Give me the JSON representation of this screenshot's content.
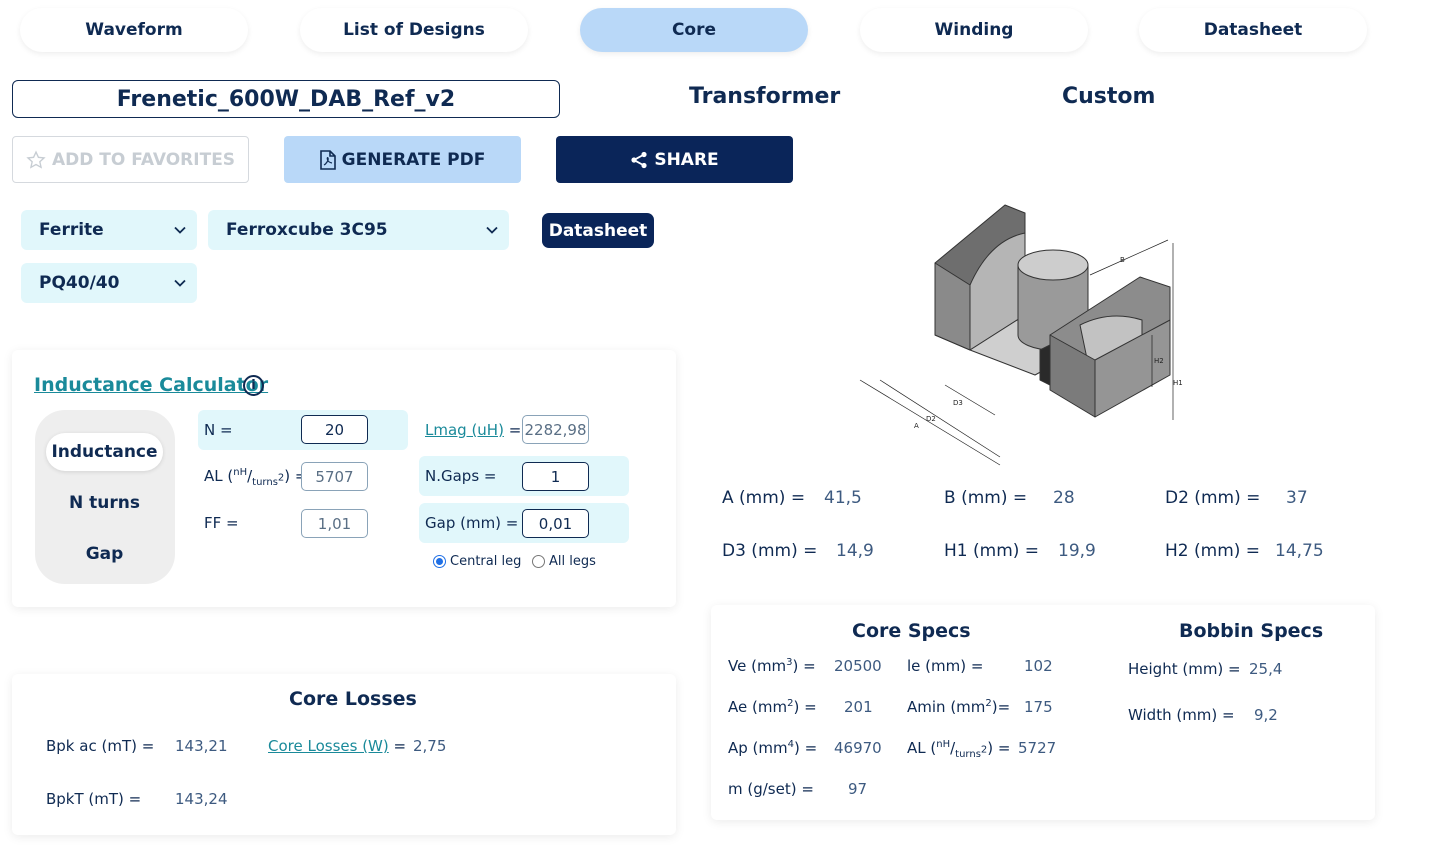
{
  "tabs": [
    "Waveform",
    "List of Designs",
    "Core",
    "Winding",
    "Datasheet"
  ],
  "design": {
    "name": "Frenetic_600W_DAB_Ref_v2",
    "type": "Transformer",
    "shape_type": "Custom"
  },
  "actions": {
    "favorites": "ADD TO FAVORITES",
    "pdf": "GENERATE PDF",
    "share": "SHARE"
  },
  "selects": {
    "material_type": "Ferrite",
    "material": "Ferroxcube 3C95",
    "shape": "PQ40/40",
    "datasheet": "Datasheet"
  },
  "inductance": {
    "title": "Inductance Calculator",
    "modes": [
      "Inductance",
      "N turns",
      "Gap"
    ],
    "n_label": "N =",
    "n_value": "20",
    "al_label_pre": "AL (",
    "al_unit_num": "nH",
    "al_unit_den": "turns",
    "al_label_post": ") =",
    "al_value": "5707",
    "ff_label": "FF =",
    "ff_value": "1,01",
    "lmag_label": "Lmag (uH)",
    "lmag_eq": "=",
    "lmag_value": "2282,98",
    "ngaps_label": "N.Gaps =",
    "ngaps_value": "1",
    "gap_label": "Gap (mm) =",
    "gap_value": "0,01",
    "radio_central": "Central leg",
    "radio_all": "All legs"
  },
  "dimensions": {
    "a_label": "A (mm) =",
    "a_value": "41,5",
    "b_label": "B (mm) =",
    "b_value": "28",
    "d2_label": "D2 (mm) =",
    "d2_value": "37",
    "d3_label": "D3 (mm) =",
    "d3_value": "14,9",
    "h1_label": "H1 (mm) =",
    "h1_value": "19,9",
    "h2_label": "H2 (mm) =",
    "h2_value": "14,75"
  },
  "drawing_labels": {
    "a": "A",
    "b": "B",
    "d2": "D2",
    "d3": "D3",
    "h1": "H1",
    "h2": "H2"
  },
  "core_losses": {
    "title": "Core Losses",
    "bpk_label": "Bpk ac (mT) =",
    "bpk_value": "143,21",
    "losses_label": "Core Losses (W)",
    "losses_eq": "=",
    "losses_value": "2,75",
    "bpkt_label": "BpkT (mT) =",
    "bpkt_value": "143,24"
  },
  "core_specs": {
    "title": "Core Specs",
    "ve_label": "Ve (mm",
    "ve_exp": "3",
    "ve_post": ") =",
    "ve_value": "20500",
    "le_label": "le (mm) =",
    "le_value": "102",
    "ae_label": "Ae (mm",
    "ae_exp": "2",
    "ae_post": ") =",
    "ae_value": "201",
    "amin_label": "Amin (mm",
    "amin_exp": "2",
    "amin_post": ")=",
    "amin_value": "175",
    "ap_label": "Ap (mm",
    "ap_exp": "4",
    "ap_post": ") =",
    "ap_value": "46970",
    "al_pre": "AL (",
    "al_num": "nH",
    "al_den": "turns",
    "al_post": ") =",
    "al_value": "5727",
    "m_label": "m (g/set) =",
    "m_value": "97"
  },
  "bobbin_specs": {
    "title": "Bobbin Specs",
    "height_label": "Height (mm) =",
    "height_value": "25,4",
    "width_label": "Width (mm) =",
    "width_value": "9,2"
  },
  "colors": {
    "navy": "#0a2559",
    "tab_active": "#b9d8f8",
    "select_bg": "#e1f7fb",
    "link_teal": "#1a8a9a"
  }
}
